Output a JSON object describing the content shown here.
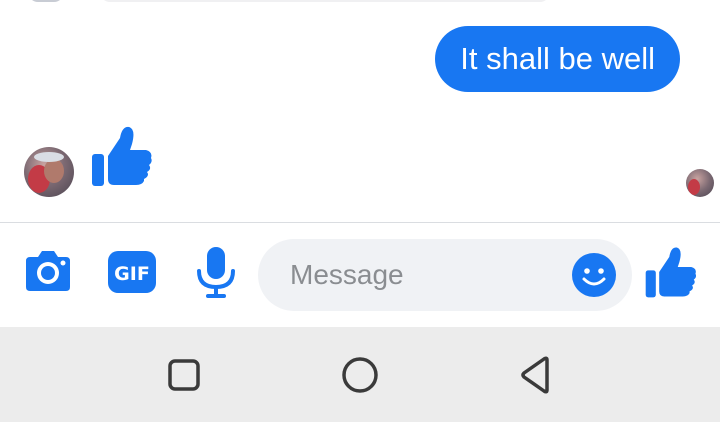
{
  "conversation": {
    "messages": [
      {
        "direction": "outgoing",
        "text": "It shall be well"
      },
      {
        "direction": "incoming",
        "type": "like-sticker"
      }
    ]
  },
  "composer": {
    "placeholder": "Message",
    "value": "",
    "gif_label": "GIF"
  },
  "icons": {
    "camera": "camera-icon",
    "gif": "gif-icon",
    "microphone": "microphone-icon",
    "emoji": "emoji-icon",
    "like": "thumbs-up-icon",
    "nav_recents": "square-icon",
    "nav_home": "circle-icon",
    "nav_back": "triangle-back-icon"
  },
  "colors": {
    "accent": "#1877f2",
    "input_background": "#f0f2f5",
    "navbar_background": "#ececec",
    "nav_icon": "#3a3a3a"
  }
}
